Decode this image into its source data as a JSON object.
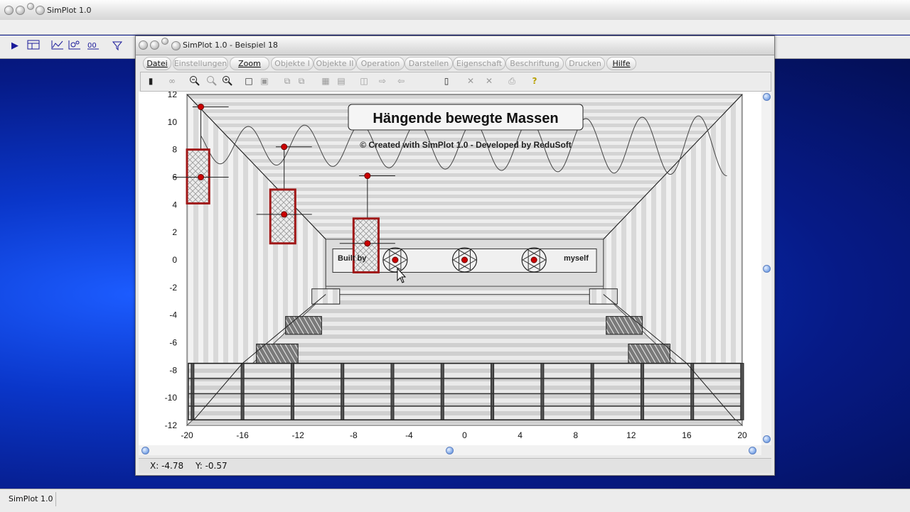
{
  "app": {
    "title": "SimPlot 1.0",
    "status_label": "SimPlot 1.0"
  },
  "window": {
    "title": "SimPlot 1.0 - Beispiel 18",
    "menu": [
      {
        "label": "Datei",
        "enabled": true
      },
      {
        "label": "Einstellungen",
        "enabled": false
      },
      {
        "label": "Zoom",
        "enabled": true
      },
      {
        "label": "Objekte I",
        "enabled": false
      },
      {
        "label": "Objekte II",
        "enabled": false
      },
      {
        "label": "Operation",
        "enabled": false
      },
      {
        "label": "Darstellen",
        "enabled": false
      },
      {
        "label": "Eigenschaft",
        "enabled": false
      },
      {
        "label": "Beschriftung",
        "enabled": false
      },
      {
        "label": "Drucken",
        "enabled": false
      },
      {
        "label": "Hilfe",
        "enabled": true
      }
    ],
    "coords": {
      "x": "X: -4.78",
      "y": "Y: -0.57"
    }
  },
  "plot": {
    "title": "Hängende bewegte Massen",
    "credit": "© Created with SimPlot 1.0 - Developed by ReduSoft",
    "banner_left": "Built by",
    "banner_right": "myself",
    "x_ticks": [
      "-20",
      "-16",
      "-12",
      "-8",
      "-4",
      "0",
      "4",
      "8",
      "12",
      "16",
      "20"
    ],
    "y_ticks": [
      "12",
      "10",
      "8",
      "6",
      "4",
      "2",
      "0",
      "-2",
      "-4",
      "-6",
      "-8",
      "-10",
      "-12"
    ],
    "xlim": [
      -20,
      20
    ],
    "ylim": [
      -12,
      12
    ]
  },
  "colors": {
    "accent_red": "#cc0000",
    "desktop_blue": "#0a36c9",
    "box_red": "#a01818"
  },
  "icons": [
    "play-icon",
    "table-icon",
    "line-chart-icon",
    "scatter-icon",
    "function-icon",
    "filter-icon",
    "zoom-out-icon",
    "zoom-fit-icon",
    "zoom-in-icon",
    "help-icon"
  ]
}
